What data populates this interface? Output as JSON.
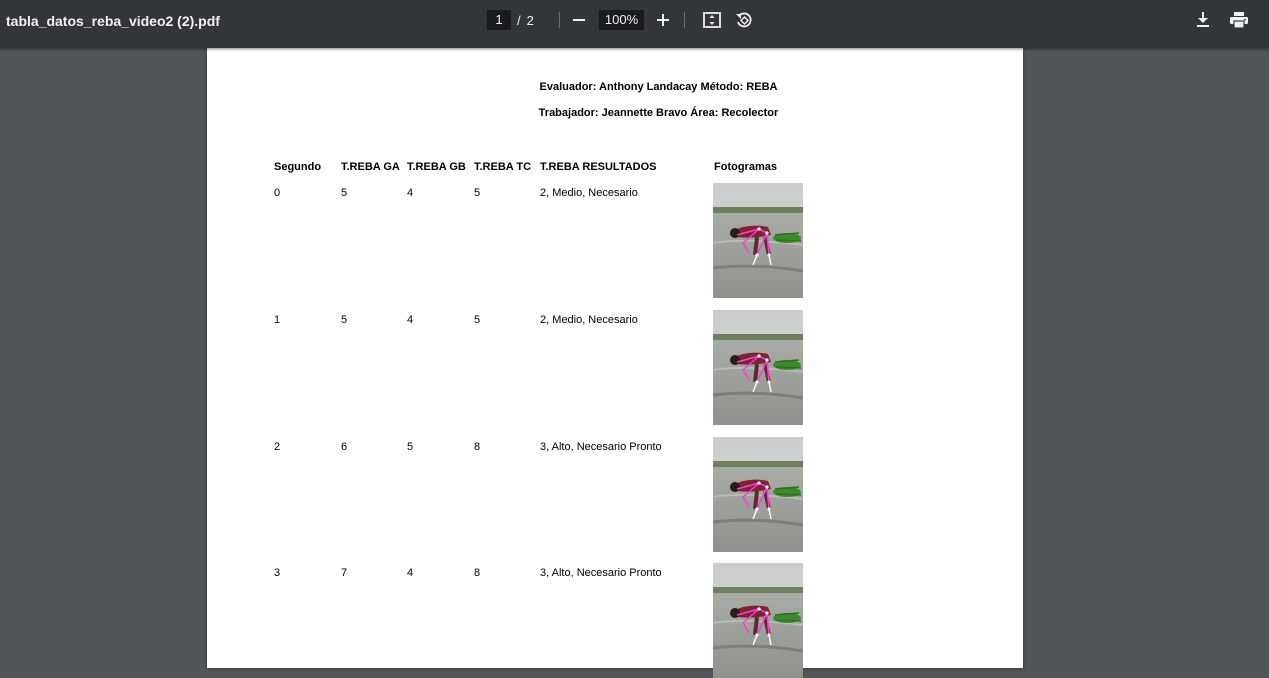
{
  "toolbar": {
    "file_name": "tabla_datos_reba_video2 (2).pdf",
    "current_page": "1",
    "page_separator": "/",
    "total_pages": "2",
    "zoom": "100%",
    "icons": {
      "zoom_out": "minus-icon",
      "zoom_in": "plus-icon",
      "fit": "fit-to-page-icon",
      "rotate": "rotate-icon",
      "download": "download-icon",
      "print": "print-icon"
    }
  },
  "document": {
    "header_line1": "Evaluador: Anthony Landacay  Método: REBA",
    "header_line2": "Trabajador: Jeannette Bravo  Área: Recolector",
    "columns": [
      "Segundo",
      "T.REBA GA",
      "T.REBA GB",
      "T.REBA TC",
      "T.REBA RESULTADOS",
      "Fotogramas"
    ],
    "rows": [
      {
        "segundo": "0",
        "ga": "5",
        "gb": "4",
        "tc": "5",
        "resultado": "2, Medio, Necesario"
      },
      {
        "segundo": "1",
        "ga": "5",
        "gb": "4",
        "tc": "5",
        "resultado": "2, Medio, Necesario"
      },
      {
        "segundo": "2",
        "ga": "6",
        "gb": "5",
        "tc": "8",
        "resultado": "3, Alto, Necesario Pronto"
      },
      {
        "segundo": "3",
        "ga": "7",
        "gb": "4",
        "tc": "8",
        "resultado": "3, Alto, Necesario Pronto"
      }
    ]
  },
  "colors": {
    "toolbar_bg": "#323639",
    "viewer_bg": "#525659",
    "page_bg": "#ffffff"
  }
}
